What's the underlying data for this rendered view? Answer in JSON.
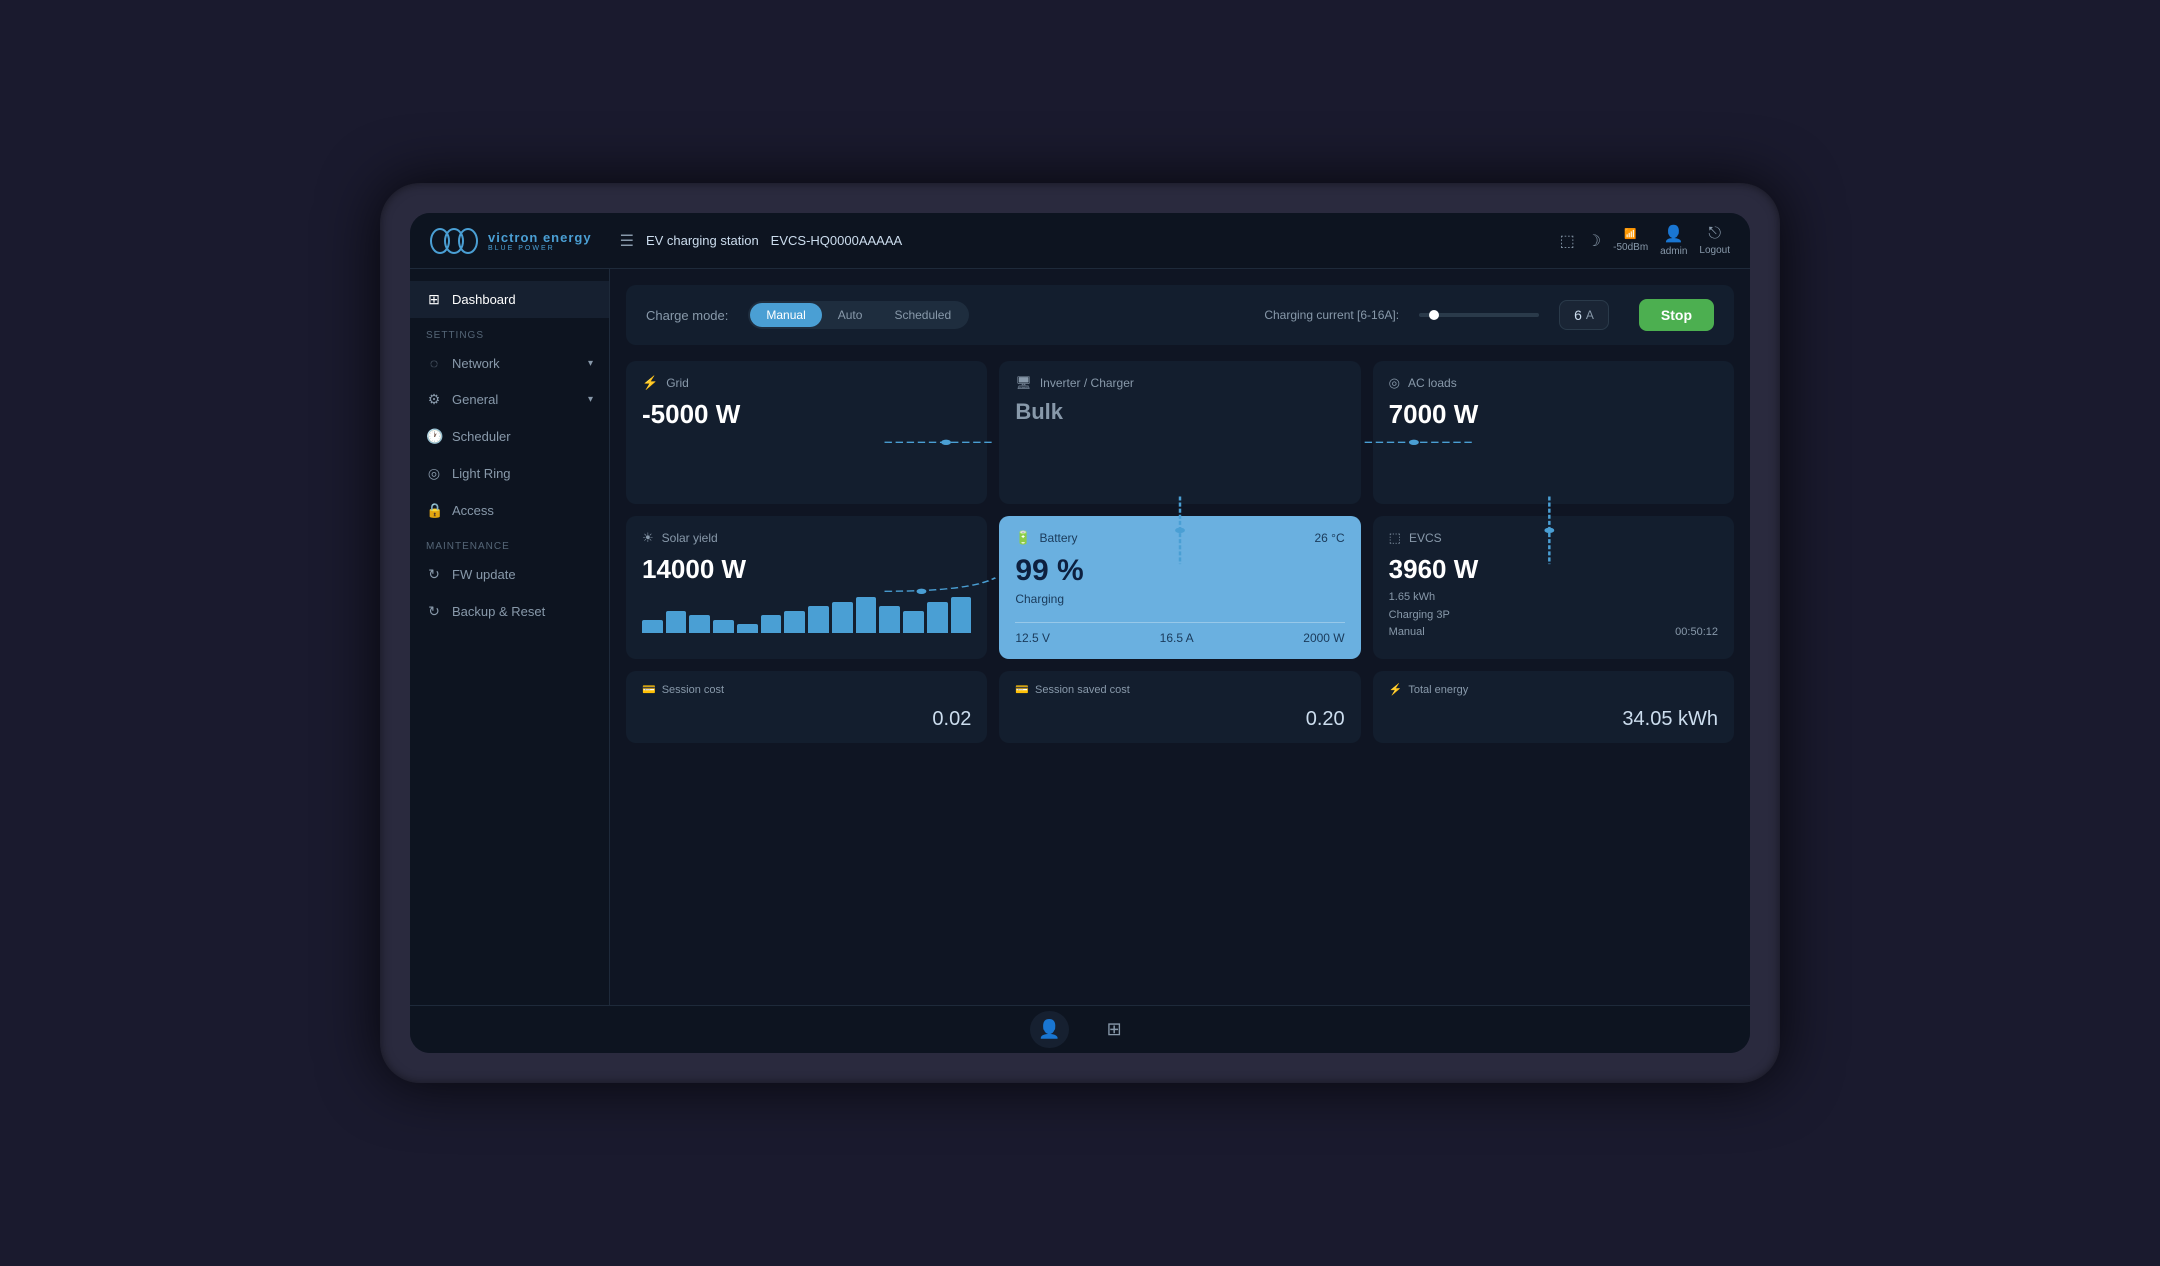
{
  "header": {
    "brand": "victron energy",
    "brand_sub": "BLUE POWER",
    "menu_label": "☰",
    "station_label": "EV charging station",
    "station_id": "EVCS-HQ0000AAAAA",
    "signal_db": "-50dBm",
    "user": "admin",
    "logout": "Logout"
  },
  "sidebar": {
    "dashboard_label": "Dashboard",
    "settings_section": "SETTINGS",
    "maintenance_section": "MAINTENANCE",
    "nav_items": [
      {
        "id": "network",
        "label": "Network",
        "has_arrow": true
      },
      {
        "id": "general",
        "label": "General",
        "has_arrow": true
      },
      {
        "id": "scheduler",
        "label": "Scheduler",
        "has_arrow": false
      },
      {
        "id": "light-ring",
        "label": "Light Ring",
        "has_arrow": false
      },
      {
        "id": "access",
        "label": "Access",
        "has_arrow": false
      }
    ],
    "maintenance_items": [
      {
        "id": "fw-update",
        "label": "FW update"
      },
      {
        "id": "backup-reset",
        "label": "Backup & Reset"
      }
    ]
  },
  "charge_mode": {
    "label": "Charge mode:",
    "tabs": [
      {
        "id": "manual",
        "label": "Manual",
        "active": true
      },
      {
        "id": "auto",
        "label": "Auto",
        "active": false
      },
      {
        "id": "scheduled",
        "label": "Scheduled",
        "active": false
      }
    ],
    "current_label": "Charging current [6-16A]:",
    "current_value": "6",
    "current_unit": "A",
    "stop_label": "Stop"
  },
  "cards": {
    "grid": {
      "icon": "⚡",
      "title": "Grid",
      "value": "-5000 W"
    },
    "inverter": {
      "icon": "🔋",
      "title": "Inverter / Charger",
      "value": "Bulk"
    },
    "ac_loads": {
      "icon": "◎",
      "title": "AC loads",
      "value": "7000 W"
    },
    "solar": {
      "icon": "☀",
      "title": "Solar yield",
      "value": "14000 W",
      "bars": [
        3,
        5,
        4,
        3,
        2,
        4,
        5,
        6,
        7,
        8,
        6,
        5,
        7,
        8
      ]
    },
    "battery": {
      "icon": "🔋",
      "title": "Battery",
      "temp": "26 °C",
      "value": "99 %",
      "status": "Charging",
      "voltage": "12.5 V",
      "current": "16.5 A",
      "power": "2000 W"
    },
    "evcs": {
      "icon": "⚡",
      "title": "EVCS",
      "value": "3960 W",
      "detail1": "1.65 kWh",
      "detail2": "Charging 3P",
      "detail3": "Manual",
      "detail4": "00:50:12"
    }
  },
  "bottom_cards": {
    "session_cost": {
      "icon": "💳",
      "label": "Session cost",
      "value": "0.02"
    },
    "session_saved": {
      "icon": "💳",
      "label": "Session saved cost",
      "value": "0.20"
    },
    "total_energy": {
      "icon": "⚡",
      "label": "Total energy",
      "value": "34.05 kWh"
    }
  },
  "bottom_nav": {
    "icons": [
      "👤",
      "⊞"
    ]
  }
}
